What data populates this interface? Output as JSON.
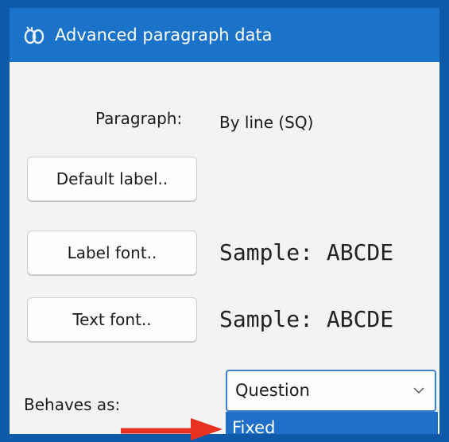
{
  "window": {
    "title": "Advanced paragraph data",
    "title_icon": "app-icon"
  },
  "paragraph": {
    "label": "Paragraph:",
    "value": "By line (SQ)"
  },
  "buttons": {
    "default_label": "Default label..",
    "label_font": "Label font..",
    "text_font": "Text font.."
  },
  "samples": {
    "label_font_sample": "Sample: ABCDE",
    "text_font_sample": "Sample: ABCDE"
  },
  "behaves_as": {
    "label": "Behaves as:",
    "selected": "Question",
    "highlighted_option": "Fixed"
  },
  "colors": {
    "titlebar": "#1b73c9",
    "highlight": "#1f6fc8",
    "arrow": "#e8321f"
  }
}
